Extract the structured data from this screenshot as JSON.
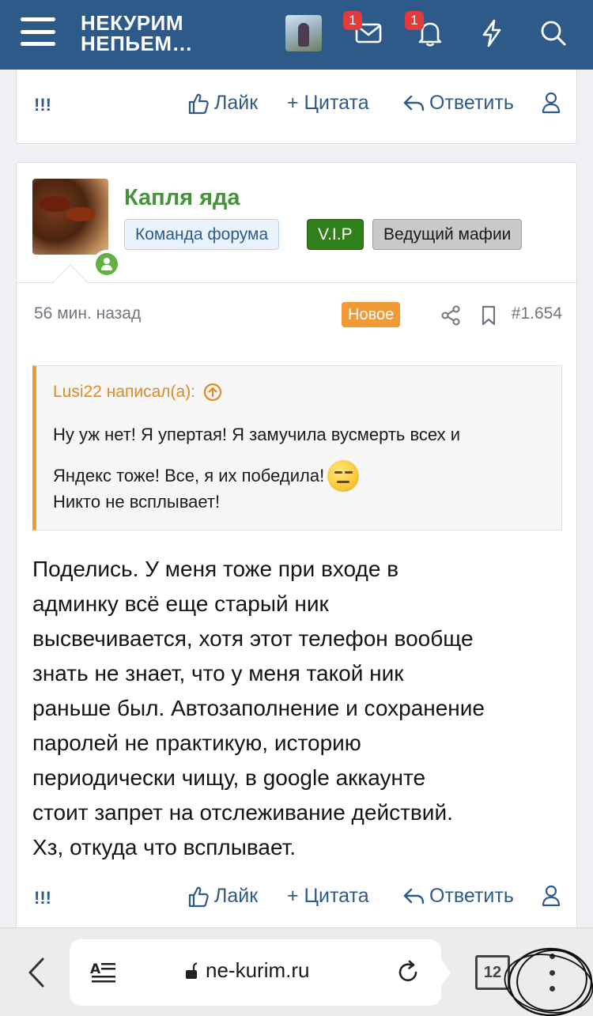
{
  "header": {
    "logo_line1": "НЕКУРИМ",
    "logo_line2": "НЕПЬЕМ…",
    "messages_badge": "1",
    "alerts_badge": "1",
    "colors": {
      "navbar": "#2e5a8a",
      "badge": "#e33b3b"
    }
  },
  "previous_post": {
    "reactions": "!!!",
    "like_label": "Лайк",
    "quote_label": "+ Цитата",
    "reply_label": "Ответить"
  },
  "post": {
    "author": "Капля яда",
    "roles": [
      "Команда форума",
      "V.I.P",
      "Ведущий мафии"
    ],
    "time": "56 мин. назад",
    "new_badge": "Новое",
    "post_number": "#1.654",
    "quote": {
      "author": "Lusi22 написал(а):",
      "line1": "Ну уж нет! Я упертая! Я замучила вусмерть всех и",
      "line2": "Яндекс тоже! Все, я их победила!",
      "line3": "Никто не всплывает!"
    },
    "body_lines": [
      "Поделись. У меня тоже при входе в",
      "админку всё еще старый ник",
      "высвечивается, хотя этот телефон вообще",
      "знать не знает, что у меня такой ник",
      "раньше был. Автозаполнение и сохранение",
      "паролей не практикую, историю",
      "периодически чищу, в google аккаунте",
      "стоит запрет на отслеживание действий.",
      "Хз, откуда что всплывает."
    ],
    "reactions": "!!!",
    "like_label": "Лайк",
    "quote_label": "+ Цитата",
    "reply_label": "Ответить",
    "colors": {
      "author": "#45923b",
      "accent": "#f29a35",
      "link": "#2e5a8a"
    }
  },
  "browser": {
    "url": "ne-kurim.ru",
    "tab_count": "12"
  }
}
